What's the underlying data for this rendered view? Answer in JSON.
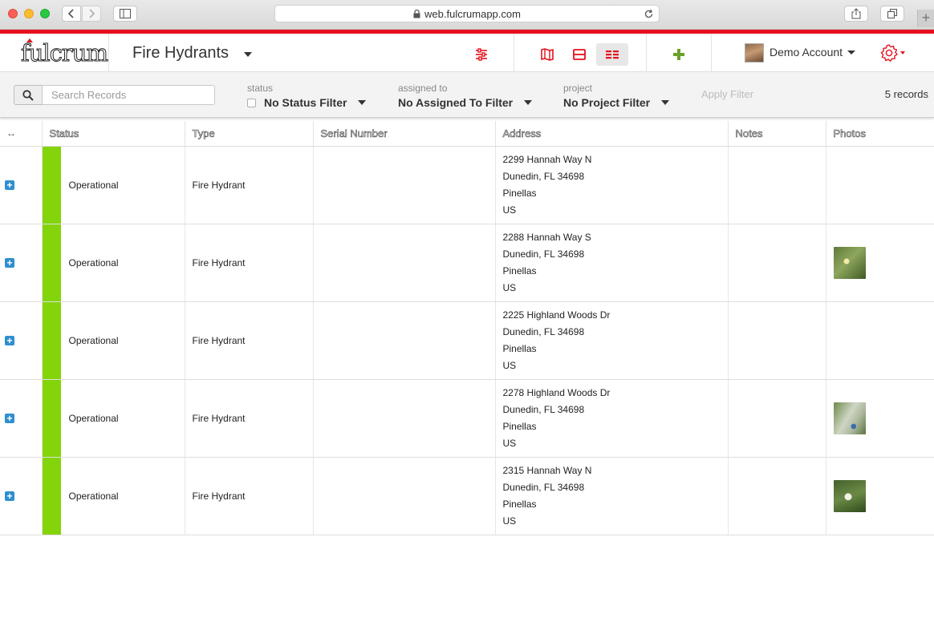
{
  "browser": {
    "url": "web.fulcrumapp.com"
  },
  "app": {
    "logo_text": "fulcrum",
    "title": "Fire Hydrants",
    "account_name": "Demo Account"
  },
  "colors": {
    "brand_red": "#e6101d",
    "add_green": "#6aa12a",
    "status_operational": "#84d40b",
    "expand_blue": "#2f8fd0"
  },
  "toolbar": {
    "icons": [
      "filter-sliders-icon",
      "map-view-icon",
      "split-view-icon",
      "table-view-icon",
      "add-record-icon",
      "gear-icon"
    ]
  },
  "filters": {
    "search_placeholder": "Search Records",
    "status_label": "status",
    "status_value": "No Status Filter",
    "assigned_label": "assigned to",
    "assigned_value": "No Assigned To Filter",
    "project_label": "project",
    "project_value": "No Project Filter",
    "apply_label": "Apply Filter",
    "record_count": "5 records"
  },
  "table": {
    "expand_header": "↔",
    "columns": [
      "Status",
      "Type",
      "Serial Number",
      "Address",
      "Notes",
      "Photos"
    ],
    "rows": [
      {
        "status": "Operational",
        "type": "Fire Hydrant",
        "serial": "",
        "address": [
          "2299 Hannah Way N",
          "Dunedin, FL 34698",
          "Pinellas",
          "US"
        ],
        "notes": "",
        "photo": false
      },
      {
        "status": "Operational",
        "type": "Fire Hydrant",
        "serial": "",
        "address": [
          "2288 Hannah Way S",
          "Dunedin, FL 34698",
          "Pinellas",
          "US"
        ],
        "notes": "",
        "photo": true
      },
      {
        "status": "Operational",
        "type": "Fire Hydrant",
        "serial": "",
        "address": [
          "2225 Highland Woods Dr",
          "Dunedin, FL 34698",
          "Pinellas",
          "US"
        ],
        "notes": "",
        "photo": false
      },
      {
        "status": "Operational",
        "type": "Fire Hydrant",
        "serial": "",
        "address": [
          "2278 Highland Woods Dr",
          "Dunedin, FL 34698",
          "Pinellas",
          "US"
        ],
        "notes": "",
        "photo": true
      },
      {
        "status": "Operational",
        "type": "Fire Hydrant",
        "serial": "",
        "address": [
          "2315 Hannah Way N",
          "Dunedin, FL 34698",
          "Pinellas",
          "US"
        ],
        "notes": "",
        "photo": true
      }
    ]
  }
}
